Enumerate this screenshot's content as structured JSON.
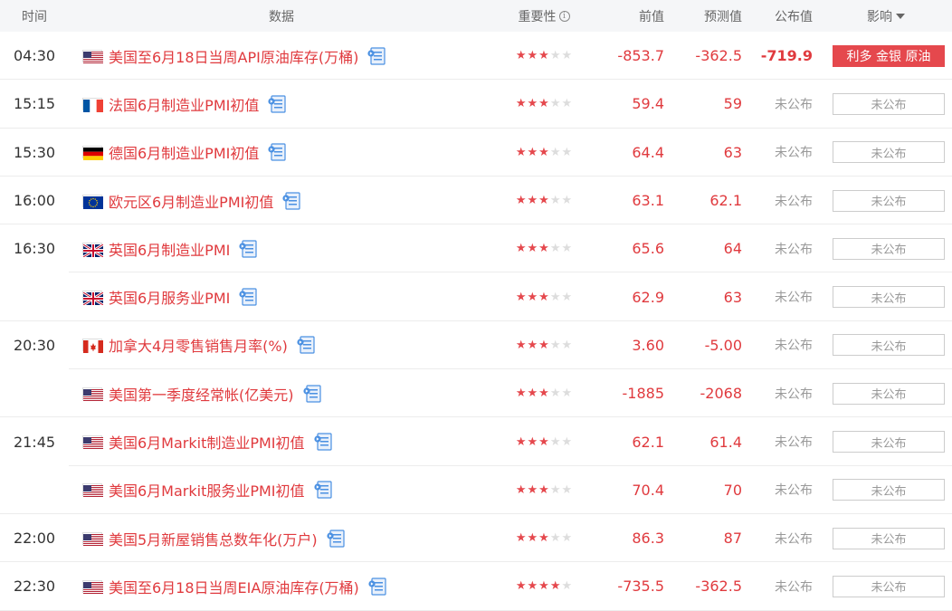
{
  "header": {
    "time": "时间",
    "data": "数据",
    "importance": "重要性",
    "previous": "前值",
    "forecast": "预测值",
    "actual": "公布值",
    "impact": "影响"
  },
  "colors": {
    "accent": "#e03a3e",
    "badge_hot": "#e5484d",
    "muted": "#999999"
  },
  "rows": [
    {
      "time": "04:30",
      "flag": "us",
      "name": "美国至6月18日当周API原油库存(万桶)",
      "stars": 3,
      "previous": "-853.7",
      "forecast": "-362.5",
      "actual": "-719.9",
      "actual_hi": true,
      "impact": "利多 金银 原油",
      "impact_hot": true,
      "group_end": true
    },
    {
      "time": "15:15",
      "flag": "fr",
      "name": "法国6月制造业PMI初值",
      "stars": 3,
      "previous": "59.4",
      "forecast": "59",
      "actual": "未公布",
      "actual_hi": false,
      "impact": "未公布",
      "impact_hot": false,
      "group_end": true
    },
    {
      "time": "15:30",
      "flag": "de",
      "name": "德国6月制造业PMI初值",
      "stars": 3,
      "previous": "64.4",
      "forecast": "63",
      "actual": "未公布",
      "actual_hi": false,
      "impact": "未公布",
      "impact_hot": false,
      "group_end": true
    },
    {
      "time": "16:00",
      "flag": "eu",
      "name": "欧元区6月制造业PMI初值",
      "stars": 3,
      "previous": "63.1",
      "forecast": "62.1",
      "actual": "未公布",
      "actual_hi": false,
      "impact": "未公布",
      "impact_hot": false,
      "group_end": true
    },
    {
      "time": "16:30",
      "flag": "gb",
      "name": "英国6月制造业PMI",
      "stars": 3,
      "previous": "65.6",
      "forecast": "64",
      "actual": "未公布",
      "actual_hi": false,
      "impact": "未公布",
      "impact_hot": false,
      "group_end": false
    },
    {
      "time": "",
      "flag": "gb",
      "name": "英国6月服务业PMI",
      "stars": 3,
      "previous": "62.9",
      "forecast": "63",
      "actual": "未公布",
      "actual_hi": false,
      "impact": "未公布",
      "impact_hot": false,
      "group_end": true
    },
    {
      "time": "20:30",
      "flag": "ca",
      "name": "加拿大4月零售销售月率(%)",
      "stars": 3,
      "previous": "3.60",
      "forecast": "-5.00",
      "actual": "未公布",
      "actual_hi": false,
      "impact": "未公布",
      "impact_hot": false,
      "group_end": false
    },
    {
      "time": "",
      "flag": "us",
      "name": "美国第一季度经常帐(亿美元)",
      "stars": 3,
      "previous": "-1885",
      "forecast": "-2068",
      "actual": "未公布",
      "actual_hi": false,
      "impact": "未公布",
      "impact_hot": false,
      "group_end": true
    },
    {
      "time": "21:45",
      "flag": "us",
      "name": "美国6月Markit制造业PMI初值",
      "stars": 3,
      "previous": "62.1",
      "forecast": "61.4",
      "actual": "未公布",
      "actual_hi": false,
      "impact": "未公布",
      "impact_hot": false,
      "group_end": false
    },
    {
      "time": "",
      "flag": "us",
      "name": "美国6月Markit服务业PMI初值",
      "stars": 3,
      "previous": "70.4",
      "forecast": "70",
      "actual": "未公布",
      "actual_hi": false,
      "impact": "未公布",
      "impact_hot": false,
      "group_end": true
    },
    {
      "time": "22:00",
      "flag": "us",
      "name": "美国5月新屋销售总数年化(万户)",
      "stars": 3,
      "previous": "86.3",
      "forecast": "87",
      "actual": "未公布",
      "actual_hi": false,
      "impact": "未公布",
      "impact_hot": false,
      "group_end": true
    },
    {
      "time": "22:30",
      "flag": "us",
      "name": "美国至6月18日当周EIA原油库存(万桶)",
      "stars": 4,
      "previous": "-735.5",
      "forecast": "-362.5",
      "actual": "未公布",
      "actual_hi": false,
      "impact": "未公布",
      "impact_hot": false,
      "group_end": true
    }
  ]
}
